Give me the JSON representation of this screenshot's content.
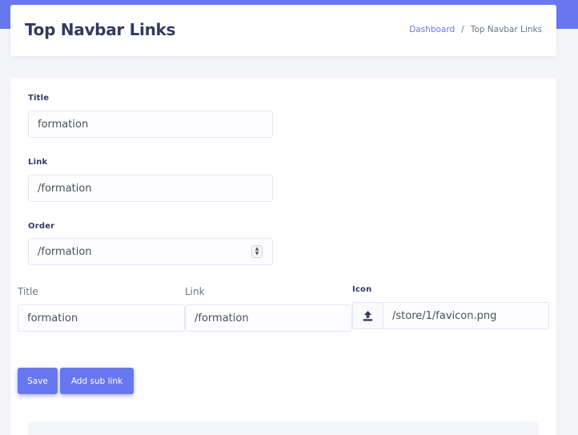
{
  "header": {
    "title": "Top Navbar Links",
    "breadcrumb": {
      "link": "Dashboard",
      "separator": "/",
      "current": "Top Navbar Links"
    }
  },
  "form": {
    "title_label": "Title",
    "title_value": "formation",
    "link_label": "Link",
    "link_value": "/formation",
    "order_label": "Order",
    "order_value": "/formation"
  },
  "sub_link": {
    "title_label": "Title",
    "title_value": "formation",
    "link_label": "Link",
    "link_value": "/formation",
    "icon_label": "Icon",
    "icon_value": "/store/1/favicon.png",
    "icon_button_icon": "upload-icon"
  },
  "actions": {
    "save_label": "Save",
    "add_sub_link_label": "Add sub link"
  },
  "colors": {
    "accent": "#6777ef",
    "heading": "#34395e",
    "background": "#f4f5f9"
  }
}
